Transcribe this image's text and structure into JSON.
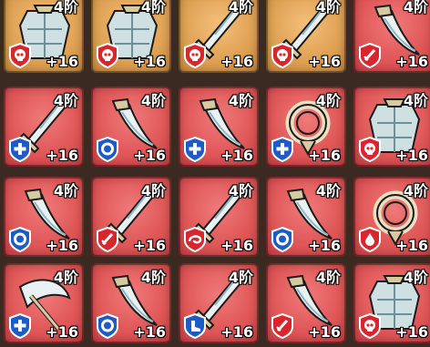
{
  "colors": {
    "gold_bg": "#e0a255",
    "red_bg": "#e05858",
    "badge_red": "#d8262c",
    "badge_blue": "#1f5bc4",
    "frame": "#3a2a22"
  },
  "cells": [
    {
      "tier": "4阶",
      "level": "+16",
      "bg": "gold",
      "badge": "red",
      "badge_icon": "skull-icon",
      "item": "armor-icon"
    },
    {
      "tier": "4阶",
      "level": "+16",
      "bg": "gold",
      "badge": "red",
      "badge_icon": "skull-icon",
      "item": "armor-icon"
    },
    {
      "tier": "4阶",
      "level": "+16",
      "bg": "gold",
      "badge": "red",
      "badge_icon": "skull-icon",
      "item": "sword-icon"
    },
    {
      "tier": "4阶",
      "level": "+16",
      "bg": "gold",
      "badge": "red",
      "badge_icon": "skull-icon",
      "item": "sword-icon"
    },
    {
      "tier": "4阶",
      "level": "+16",
      "bg": "red",
      "badge": "red",
      "badge_icon": "sword-badge-icon",
      "item": "blade-icon"
    },
    {
      "tier": "4阶",
      "level": "+16",
      "bg": "red",
      "badge": "blue",
      "badge_icon": "cross-icon",
      "item": "sword-icon"
    },
    {
      "tier": "4阶",
      "level": "+16",
      "bg": "red",
      "badge": "blue",
      "badge_icon": "ring-icon",
      "item": "blade-icon"
    },
    {
      "tier": "4阶",
      "level": "+16",
      "bg": "red",
      "badge": "blue",
      "badge_icon": "cross-icon",
      "item": "blade-icon"
    },
    {
      "tier": "4阶",
      "level": "+16",
      "bg": "red",
      "badge": "blue",
      "badge_icon": "cross-icon",
      "item": "amulet-icon"
    },
    {
      "tier": "4阶",
      "level": "+16",
      "bg": "red",
      "badge": "red",
      "badge_icon": "skull-icon",
      "item": "armor-icon"
    },
    {
      "tier": "4阶",
      "level": "+16",
      "bg": "red",
      "badge": "blue",
      "badge_icon": "ring-icon",
      "item": "blade-icon"
    },
    {
      "tier": "4阶",
      "level": "+16",
      "bg": "red",
      "badge": "red",
      "badge_icon": "sword-badge-icon",
      "item": "sword-icon"
    },
    {
      "tier": "4阶",
      "level": "+16",
      "bg": "red",
      "badge": "red",
      "badge_icon": "swirl-icon",
      "item": "sword-icon"
    },
    {
      "tier": "4阶",
      "level": "+16",
      "bg": "red",
      "badge": "blue",
      "badge_icon": "ring-icon",
      "item": "blade-icon"
    },
    {
      "tier": "4阶",
      "level": "+16",
      "bg": "red",
      "badge": "red",
      "badge_icon": "drop-icon",
      "item": "amulet-icon"
    },
    {
      "tier": "4阶",
      "level": "+16",
      "bg": "red",
      "badge": "blue",
      "badge_icon": "cross-icon",
      "item": "axe-icon"
    },
    {
      "tier": "4阶",
      "level": "+16",
      "bg": "red",
      "badge": "blue",
      "badge_icon": "ring-icon",
      "item": "blade-icon"
    },
    {
      "tier": "4阶",
      "level": "+16",
      "bg": "red",
      "badge": "blue",
      "badge_icon": "boot-icon",
      "item": "sword-icon"
    },
    {
      "tier": "4阶",
      "level": "+16",
      "bg": "red",
      "badge": "red",
      "badge_icon": "sword-badge-icon",
      "item": "blade-icon"
    },
    {
      "tier": "4阶",
      "level": "+16",
      "bg": "red",
      "badge": "red",
      "badge_icon": "skull-icon",
      "item": "armor-icon"
    }
  ]
}
